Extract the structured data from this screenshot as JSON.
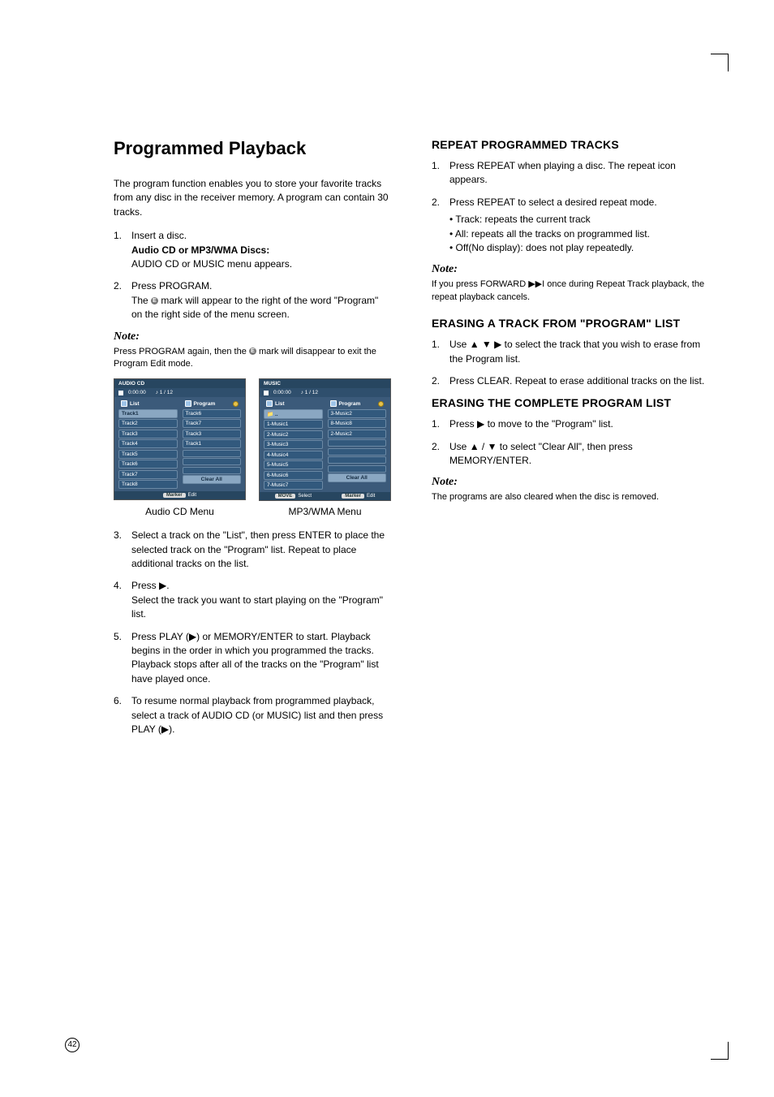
{
  "page_number": "42",
  "left": {
    "title": "Programmed Playback",
    "intro": "The program function enables you to store your favorite tracks from any disc in the receiver memory. A program can contain 30 tracks.",
    "steps_a": [
      {
        "n": "1.",
        "line1": "Insert a disc.",
        "bold": "Audio CD or MP3/WMA Discs:",
        "line3": "AUDIO CD or MUSIC menu appears."
      },
      {
        "n": "2.",
        "line1": "Press PROGRAM.",
        "line2_pre": "The ",
        "line2_post": " mark will appear to the right of the word \"Program\" on the right side of the menu screen."
      }
    ],
    "note1_heading": "Note:",
    "note1_body_pre": "Press PROGRAM again, then the ",
    "note1_body_post": " mark will disappear to exit the Program Edit mode.",
    "cd_menu": {
      "title": "AUDIO CD",
      "time": "0:00:00",
      "counter": "1 / 12",
      "list_label": "List",
      "program_label": "Program",
      "e_mark": "E",
      "list_items": [
        "Track1",
        "Track2",
        "Track3",
        "Track4",
        "Track5",
        "Track6",
        "Track7",
        "Track8"
      ],
      "prog_items": [
        "Track6",
        "Track7",
        "Track3",
        "Track1",
        "",
        "",
        "",
        ""
      ],
      "clear_all": "Clear All",
      "footer_marker": "Marker",
      "footer_edit": "Edit"
    },
    "music_menu": {
      "title": "MUSIC",
      "time": "0:00:00",
      "counter": "1 / 12",
      "list_label": "List",
      "program_label": "Program",
      "e_mark": "E",
      "folder_row": "..",
      "list_items": [
        "1-Music1",
        "2-Music2",
        "3-Music3",
        "4-Music4",
        "5-Music5",
        "6-Music6",
        "7-Music7"
      ],
      "prog_items": [
        "3-Music2",
        "8-Music8",
        "2-Music2",
        "",
        "",
        "",
        ""
      ],
      "clear_all": "Clear All",
      "footer_move": "MOVE",
      "footer_move_sub": "Select",
      "footer_marker": "Marker",
      "footer_edit": "Edit"
    },
    "caption_cd": "Audio CD Menu",
    "caption_mp3": "MP3/WMA Menu",
    "steps_b": [
      {
        "n": "3.",
        "body": "Select a track on the \"List\", then press ENTER to place the selected track on the \"Program\" list. Repeat to place additional tracks on the list."
      },
      {
        "n": "4.",
        "line1_pre": "Press ",
        "line1_glyph": "▶",
        "line1_post": ".",
        "line2": "Select the track you want to start playing on the \"Program\" list."
      },
      {
        "n": "5.",
        "body_pre": "Press PLAY (",
        "body_glyph": "▶",
        "body_post": ") or MEMORY/ENTER to start. Playback begins in the order in which you programmed the tracks. Playback stops after all of the tracks on the \"Program\" list have played once."
      },
      {
        "n": "6.",
        "body_pre": "To resume normal playback from programmed playback, select a track of AUDIO CD (or MUSIC) list and then press PLAY (",
        "body_glyph": "▶",
        "body_post": ")."
      }
    ]
  },
  "right": {
    "h_repeat": "REPEAT PROGRAMMED TRACKS",
    "repeat_steps": [
      {
        "n": "1.",
        "body": "Press REPEAT when playing a disc. The repeat icon appears."
      },
      {
        "n": "2.",
        "body": "Press REPEAT to select a desired repeat mode.",
        "bullets": [
          "Track: repeats the current track",
          "All: repeats all the tracks on programmed list.",
          "Off(No display): does not play repeatedly."
        ]
      }
    ],
    "note2_heading": "Note:",
    "note2_body_pre": "If you press FORWARD ",
    "note2_glyph": "▶▶I",
    "note2_body_post": " once during Repeat Track playback, the repeat playback cancels.",
    "h_erase_track": "ERASING A TRACK FROM \"PROGRAM\" LIST",
    "erase_track_steps": [
      {
        "n": "1.",
        "pre": "Use ",
        "glyphs": "▲ ▼ ▶",
        "post": " to select the track that you wish to erase from the Program list."
      },
      {
        "n": "2.",
        "body": "Press CLEAR. Repeat to erase additional tracks on the list."
      }
    ],
    "h_erase_all": "ERASING THE COMPLETE PROGRAM LIST",
    "erase_all_steps": [
      {
        "n": "1.",
        "pre": "Press ",
        "glyph": "▶",
        "post": " to move to the \"Program\" list."
      },
      {
        "n": "2.",
        "pre": "Use ",
        "glyphs": "▲ / ▼",
        "post": " to select \"Clear All\", then press MEMORY/ENTER."
      }
    ],
    "note3_heading": "Note:",
    "note3_body": "The programs are also cleared when the disc is removed."
  },
  "e_mark_text": "E"
}
